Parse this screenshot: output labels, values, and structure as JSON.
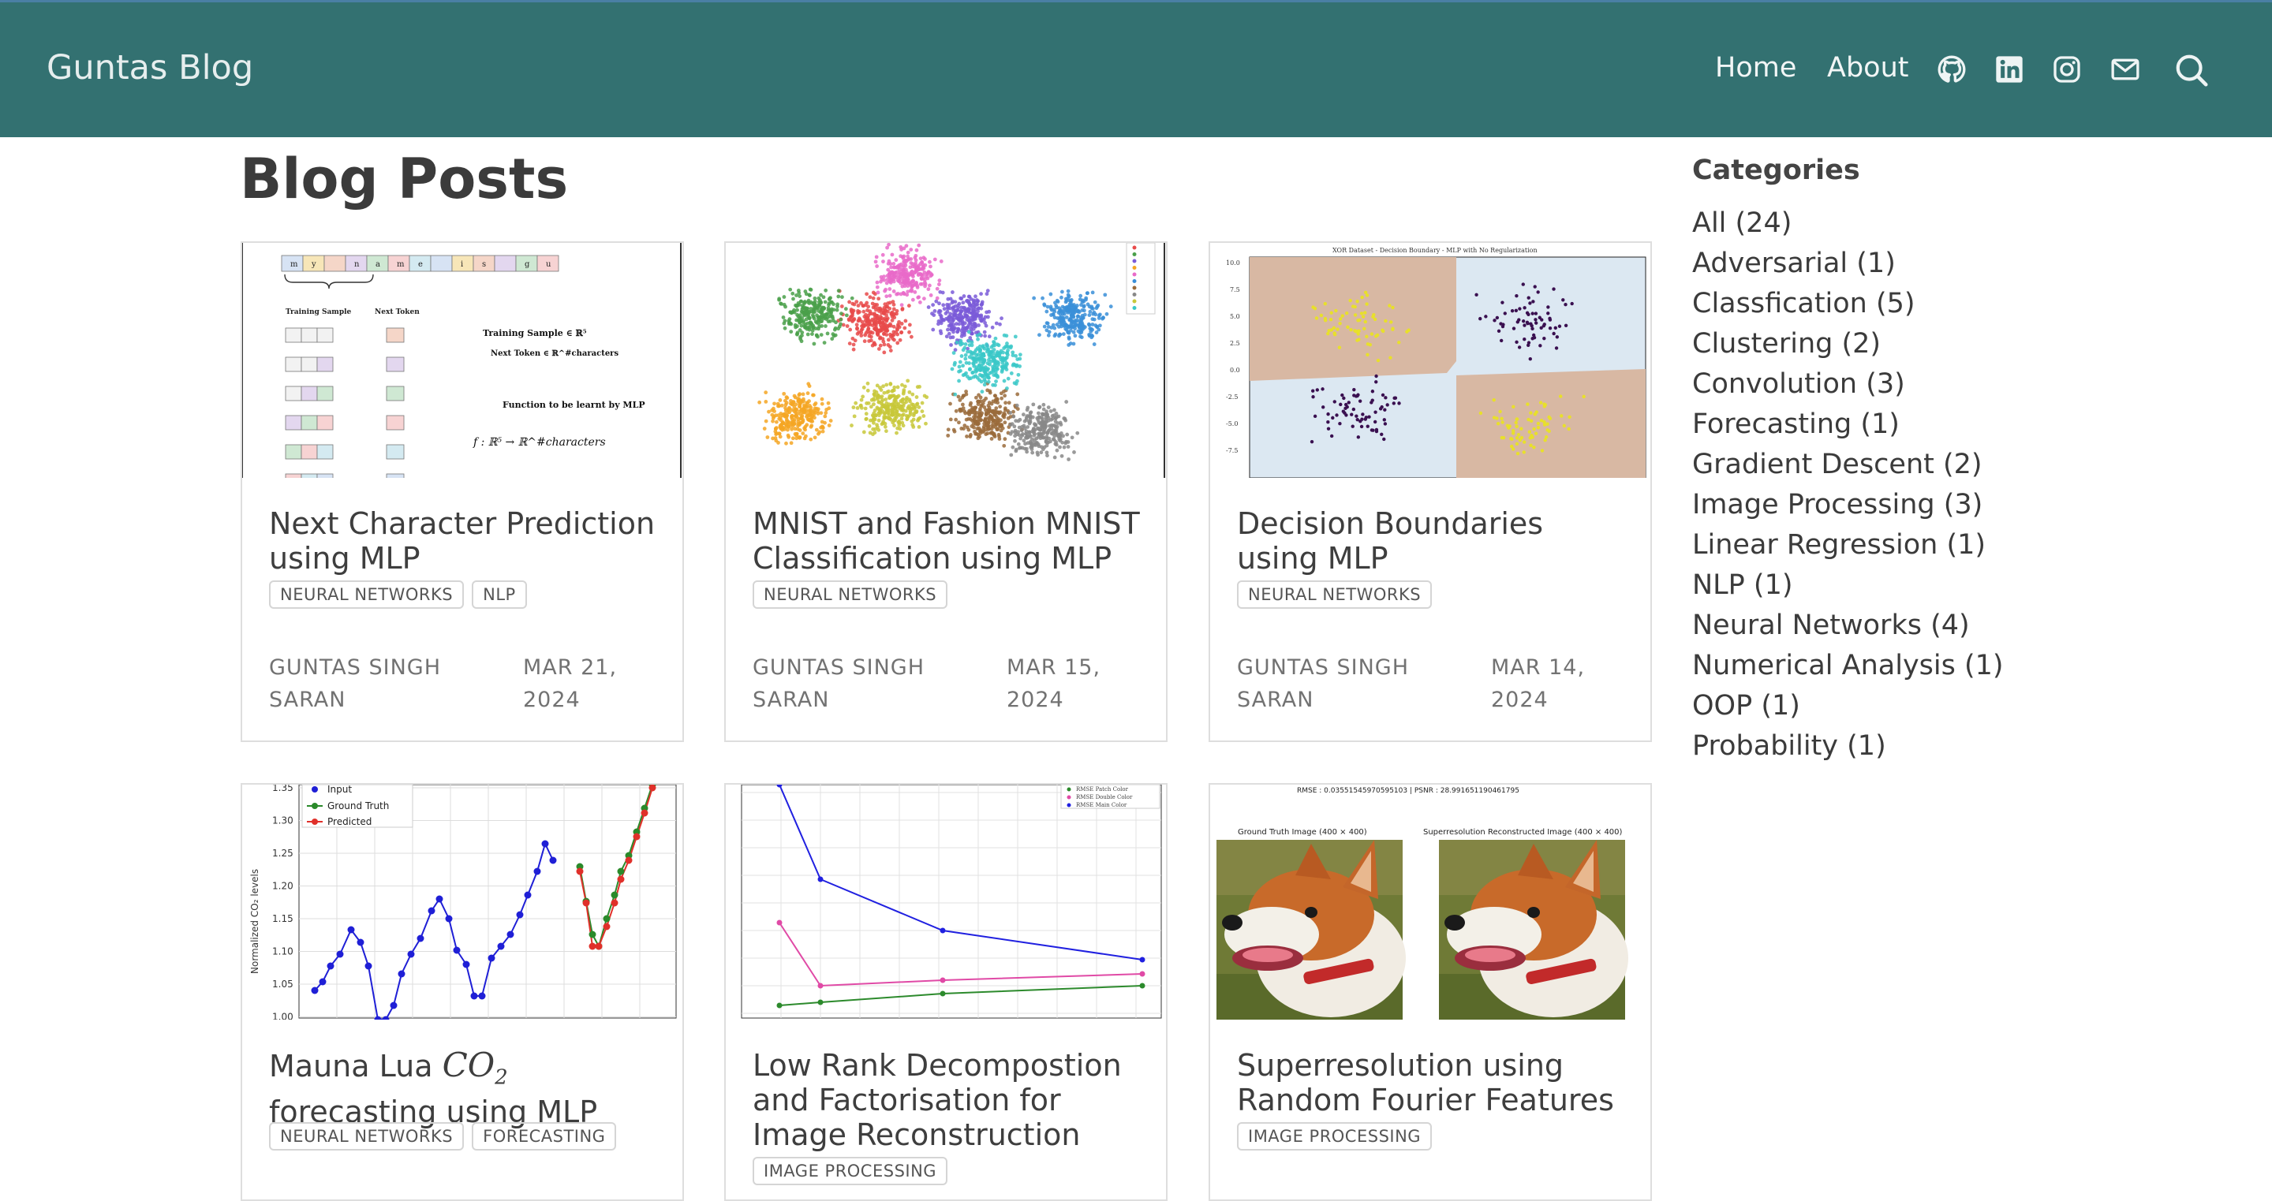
{
  "header": {
    "brand": "Guntas Blog",
    "nav": [
      {
        "label": "Home"
      },
      {
        "label": "About"
      }
    ],
    "icons": [
      "github-icon",
      "linkedin-icon",
      "instagram-icon",
      "email-icon",
      "search-icon"
    ]
  },
  "main": {
    "title": "Blog Posts",
    "posts": [
      {
        "title": "Next Character Prediction using MLP",
        "tags": [
          "NEURAL NETWORKS",
          "NLP"
        ],
        "author": "GUNTAS SINGH SARAN",
        "date": "MAR 21, 2024"
      },
      {
        "title": "MNIST and Fashion MNIST Classification using MLP",
        "tags": [
          "NEURAL NETWORKS"
        ],
        "author": "GUNTAS SINGH SARAN",
        "date": "MAR 15, 2024"
      },
      {
        "title": "Decision Boundaries using MLP",
        "tags": [
          "NEURAL NETWORKS"
        ],
        "author": "GUNTAS SINGH SARAN",
        "date": "MAR 14, 2024"
      },
      {
        "title_prefix": "Mauna Lua ",
        "title_math": "CO",
        "title_sub": "2",
        "title_suffix": " forecasting using MLP",
        "tags": [
          "NEURAL NETWORKS",
          "FORECASTING"
        ]
      },
      {
        "title": "Low Rank Decompostion and Factorisation for Image Reconstruction",
        "tags": [
          "IMAGE PROCESSING"
        ]
      },
      {
        "title": "Superresolution using Random Fourier Features",
        "tags": [
          "IMAGE PROCESSING"
        ]
      }
    ]
  },
  "thumbnails": {
    "nlp": {
      "letters": [
        "m",
        "y",
        "",
        "n",
        "a",
        "m",
        "e",
        "",
        "i",
        "s",
        "",
        "g",
        "u"
      ],
      "training_sample": "Training Sample",
      "next_token": "Next Token",
      "train_eq": "Training Sample ∈ ℝ⁵",
      "next_eq": "Next Token ∈ ℝ^#characters",
      "func_label": "Function to be learnt by MLP",
      "func_eq": "f : ℝ⁵ → ℝ^#characters"
    },
    "boundary": {
      "title": "XOR Dataset - Decision Boundary - MLP with No Regularization"
    },
    "co2": {
      "ylabel": "Normalized CO₂ levels",
      "legend": [
        "Input",
        "Ground Truth",
        "Predicted"
      ],
      "yticks": [
        "1.35",
        "1.30",
        "1.25",
        "1.20",
        "1.15",
        "1.10",
        "1.05",
        "1.00"
      ]
    },
    "lowrank": {
      "legend": [
        "RMSE Patch Color",
        "RMSE Double Color",
        "RMSE Main Color"
      ]
    },
    "superres": {
      "header": "RMSE : 0.03551545970595103 | PSNR : 28.991651190461795",
      "left": "Ground Truth Image (400 × 400)",
      "right": "Superresolution Reconstructed Image (400 × 400)"
    }
  },
  "sidebar": {
    "title": "Categories",
    "items": [
      "All (24)",
      "Adversarial (1)",
      "Classfication (5)",
      "Clustering (2)",
      "Convolution (3)",
      "Forecasting (1)",
      "Gradient Descent (2)",
      "Image Processing (3)",
      "Linear Regression (1)",
      "NLP (1)",
      "Neural Networks (4)",
      "Numerical Analysis (1)",
      "OOP (1)",
      "Probability (1)"
    ]
  },
  "colors": {
    "navbar": "#337171",
    "text": "#3b3b3b",
    "accent": "#4a7fa4"
  }
}
